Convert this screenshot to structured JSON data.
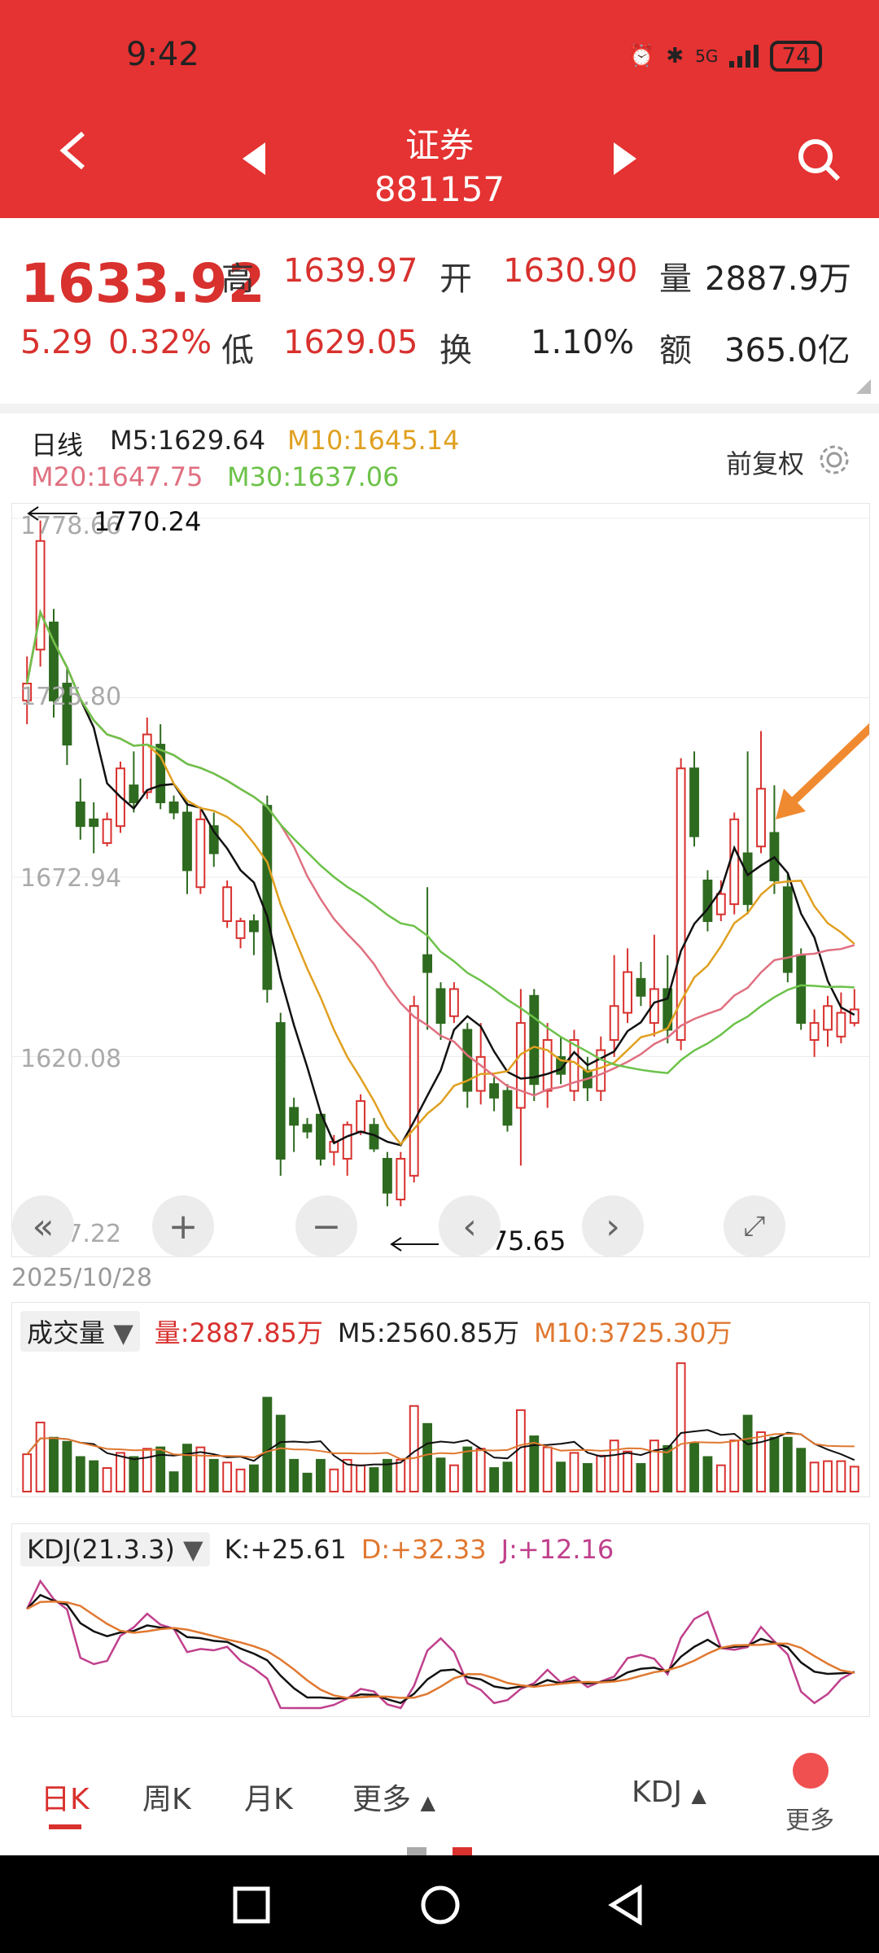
{
  "status": {
    "time": "9:42",
    "network": "5G",
    "battery": "74"
  },
  "nav": {
    "title": "证券",
    "code": "881157"
  },
  "quote": {
    "price": "1633.92",
    "change": "5.29",
    "change_pct": "0.32%",
    "high_label": "高",
    "high": "1639.97",
    "low_label": "低",
    "low": "1629.05",
    "open_label": "开",
    "open": "1630.90",
    "turnover_label": "换",
    "turnover": "1.10%",
    "volume_label": "量",
    "volume": "2887.9万",
    "amount_label": "额",
    "amount": "365.0亿"
  },
  "ma": {
    "period": "日线",
    "m5": "M5:1629.64",
    "m10": "M10:1645.14",
    "m20": "M20:1647.75",
    "m30": "M30:1637.06",
    "adjust": "前复权"
  },
  "main_chart": {
    "y_ticks": [
      "1778.66",
      "1725.80",
      "1672.94",
      "1620.08",
      "1567.22"
    ],
    "max_label": "1770.24",
    "min_label": "1575.65",
    "date": "2025/10/28",
    "colors": {
      "up": "#d8312e",
      "down": "#2e6a1f",
      "m5": "#111111",
      "m10": "#e0a020",
      "m20": "#e07080",
      "m30": "#6cc24a",
      "arrow": "#f08a30"
    }
  },
  "volume": {
    "selector": "成交量",
    "vol": "量:2887.85万",
    "m5": "M5:2560.85万",
    "m10": "M10:3725.30万"
  },
  "kdj": {
    "selector": "KDJ(21.3.3)",
    "k": "K:+25.61",
    "d": "D:+32.33",
    "j": "J:+12.16"
  },
  "tabs": {
    "day": "日K",
    "week": "周K",
    "month": "月K",
    "more": "更多",
    "indicator": "KDJ",
    "more2": "更多"
  },
  "chart_data": {
    "type": "candlestick",
    "ylim": [
      1567.22,
      1778.66
    ],
    "candles": [
      {
        "o": 1725,
        "c": 1730,
        "h": 1738,
        "l": 1718
      },
      {
        "o": 1740,
        "c": 1772,
        "h": 1778,
        "l": 1735
      },
      {
        "o": 1748,
        "c": 1725,
        "h": 1752,
        "l": 1720
      },
      {
        "o": 1730,
        "c": 1712,
        "h": 1735,
        "l": 1706
      },
      {
        "o": 1695,
        "c": 1688,
        "h": 1702,
        "l": 1684
      },
      {
        "o": 1690,
        "c": 1688,
        "h": 1695,
        "l": 1680
      },
      {
        "o": 1683,
        "c": 1690,
        "h": 1692,
        "l": 1682
      },
      {
        "o": 1688,
        "c": 1705,
        "h": 1707,
        "l": 1686
      },
      {
        "o": 1700,
        "c": 1695,
        "h": 1710,
        "l": 1692
      },
      {
        "o": 1698,
        "c": 1715,
        "h": 1720,
        "l": 1696
      },
      {
        "o": 1712,
        "c": 1695,
        "h": 1718,
        "l": 1693
      },
      {
        "o": 1695,
        "c": 1692,
        "h": 1697,
        "l": 1690
      },
      {
        "o": 1692,
        "c": 1675,
        "h": 1695,
        "l": 1668
      },
      {
        "o": 1670,
        "c": 1690,
        "h": 1693,
        "l": 1668
      },
      {
        "o": 1688,
        "c": 1680,
        "h": 1692,
        "l": 1676
      },
      {
        "o": 1660,
        "c": 1670,
        "h": 1672,
        "l": 1658
      },
      {
        "o": 1655,
        "c": 1660,
        "h": 1661,
        "l": 1652
      },
      {
        "o": 1660,
        "c": 1657,
        "h": 1662,
        "l": 1650
      },
      {
        "o": 1694,
        "c": 1640,
        "h": 1697,
        "l": 1636
      },
      {
        "o": 1630,
        "c": 1590,
        "h": 1633,
        "l": 1585
      },
      {
        "o": 1605,
        "c": 1600,
        "h": 1608,
        "l": 1592
      },
      {
        "o": 1600,
        "c": 1598,
        "h": 1602,
        "l": 1596
      },
      {
        "o": 1603,
        "c": 1590,
        "h": 1604,
        "l": 1588
      },
      {
        "o": 1592,
        "c": 1595,
        "h": 1597,
        "l": 1588
      },
      {
        "o": 1590,
        "c": 1600,
        "h": 1601,
        "l": 1585
      },
      {
        "o": 1598,
        "c": 1607,
        "h": 1609,
        "l": 1597
      },
      {
        "o": 1600,
        "c": 1593,
        "h": 1602,
        "l": 1592
      },
      {
        "o": 1590,
        "c": 1580,
        "h": 1592,
        "l": 1576
      },
      {
        "o": 1578,
        "c": 1590,
        "h": 1592,
        "l": 1576
      },
      {
        "o": 1585,
        "c": 1635,
        "h": 1638,
        "l": 1583
      },
      {
        "o": 1650,
        "c": 1645,
        "h": 1670,
        "l": 1628
      },
      {
        "o": 1640,
        "c": 1630,
        "h": 1642,
        "l": 1625
      },
      {
        "o": 1632,
        "c": 1640,
        "h": 1642,
        "l": 1630
      },
      {
        "o": 1628,
        "c": 1610,
        "h": 1630,
        "l": 1605
      },
      {
        "o": 1610,
        "c": 1620,
        "h": 1630,
        "l": 1606
      },
      {
        "o": 1612,
        "c": 1608,
        "h": 1614,
        "l": 1604
      },
      {
        "o": 1610,
        "c": 1600,
        "h": 1612,
        "l": 1598
      },
      {
        "o": 1605,
        "c": 1630,
        "h": 1640,
        "l": 1588
      },
      {
        "o": 1638,
        "c": 1612,
        "h": 1640,
        "l": 1607
      },
      {
        "o": 1610,
        "c": 1625,
        "h": 1630,
        "l": 1605
      },
      {
        "o": 1620,
        "c": 1615,
        "h": 1626,
        "l": 1612
      },
      {
        "o": 1610,
        "c": 1625,
        "h": 1628,
        "l": 1607
      },
      {
        "o": 1616,
        "c": 1611,
        "h": 1620,
        "l": 1607
      },
      {
        "o": 1610,
        "c": 1622,
        "h": 1626,
        "l": 1607
      },
      {
        "o": 1625,
        "c": 1635,
        "h": 1650,
        "l": 1620
      },
      {
        "o": 1633,
        "c": 1645,
        "h": 1652,
        "l": 1630
      },
      {
        "o": 1643,
        "c": 1638,
        "h": 1648,
        "l": 1635
      },
      {
        "o": 1630,
        "c": 1640,
        "h": 1656,
        "l": 1626
      },
      {
        "o": 1640,
        "c": 1628,
        "h": 1650,
        "l": 1624
      },
      {
        "o": 1625,
        "c": 1705,
        "h": 1708,
        "l": 1622
      },
      {
        "o": 1705,
        "c": 1685,
        "h": 1710,
        "l": 1682
      },
      {
        "o": 1672,
        "c": 1660,
        "h": 1675,
        "l": 1657
      },
      {
        "o": 1662,
        "c": 1668,
        "h": 1672,
        "l": 1660
      },
      {
        "o": 1665,
        "c": 1690,
        "h": 1692,
        "l": 1662
      },
      {
        "o": 1680,
        "c": 1665,
        "h": 1710,
        "l": 1662
      },
      {
        "o": 1682,
        "c": 1699,
        "h": 1716,
        "l": 1680
      },
      {
        "o": 1686,
        "c": 1672,
        "h": 1700,
        "l": 1668
      },
      {
        "o": 1670,
        "c": 1645,
        "h": 1674,
        "l": 1642
      },
      {
        "o": 1650,
        "c": 1630,
        "h": 1652,
        "l": 1628
      },
      {
        "o": 1625,
        "c": 1630,
        "h": 1634,
        "l": 1620
      },
      {
        "o": 1628,
        "c": 1635,
        "h": 1638,
        "l": 1623
      },
      {
        "o": 1626,
        "c": 1633,
        "h": 1639,
        "l": 1624
      },
      {
        "o": 1630,
        "c": 1634,
        "h": 1640,
        "l": 1629
      }
    ]
  }
}
